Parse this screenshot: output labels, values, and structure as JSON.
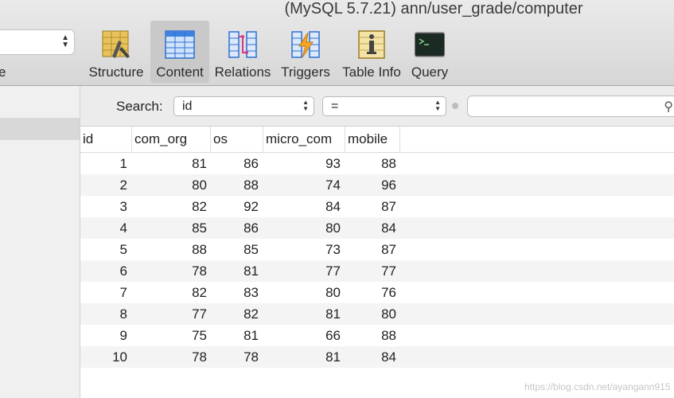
{
  "window": {
    "title": "(MySQL 5.7.21) ann/user_grade/computer"
  },
  "toolbar": {
    "database_label": "e",
    "buttons": [
      {
        "label": "Structure",
        "icon": "structure-icon"
      },
      {
        "label": "Content",
        "icon": "content-icon"
      },
      {
        "label": "Relations",
        "icon": "relations-icon"
      },
      {
        "label": "Triggers",
        "icon": "triggers-icon"
      },
      {
        "label": "Table Info",
        "icon": "table-info-icon"
      },
      {
        "label": "Query",
        "icon": "query-icon"
      }
    ],
    "active": "Content"
  },
  "filter": {
    "search_label": "Search:",
    "field": "id",
    "operator": "=",
    "value": ""
  },
  "table": {
    "columns": [
      "id",
      "com_org",
      "os",
      "micro_com",
      "mobile"
    ],
    "rows": [
      [
        "1",
        "81",
        "86",
        "93",
        "88"
      ],
      [
        "2",
        "80",
        "88",
        "74",
        "96"
      ],
      [
        "3",
        "82",
        "92",
        "84",
        "87"
      ],
      [
        "4",
        "85",
        "86",
        "80",
        "84"
      ],
      [
        "5",
        "88",
        "85",
        "73",
        "87"
      ],
      [
        "6",
        "78",
        "81",
        "77",
        "77"
      ],
      [
        "7",
        "82",
        "83",
        "80",
        "76"
      ],
      [
        "8",
        "77",
        "82",
        "81",
        "80"
      ],
      [
        "9",
        "75",
        "81",
        "66",
        "88"
      ],
      [
        "10",
        "78",
        "78",
        "81",
        "84"
      ]
    ]
  },
  "watermark": "https://blog.csdn.net/ayangann915"
}
